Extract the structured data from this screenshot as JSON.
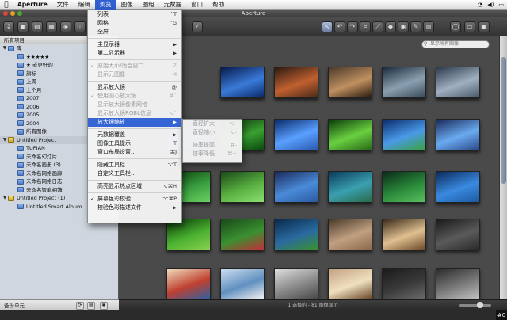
{
  "menubar": {
    "app": "Aperture",
    "items": [
      "文件",
      "编辑",
      "浏览",
      "图像",
      "图组",
      "元数据",
      "窗口",
      "帮助"
    ],
    "active_index": 2
  },
  "window": {
    "title": "Aperture"
  },
  "sidebar": {
    "header": "所有项目",
    "items": [
      {
        "label": "库",
        "level": 0,
        "icon": "folder-icon",
        "expanded": true
      },
      {
        "label": "★★★★★",
        "level": 1,
        "icon": "album-icon"
      },
      {
        "label": "★ 或更好的",
        "level": 1,
        "icon": "album-icon"
      },
      {
        "label": "旗标",
        "level": 1,
        "icon": "album-icon"
      },
      {
        "label": "上周",
        "level": 1,
        "icon": "album-icon"
      },
      {
        "label": "上个月",
        "level": 1,
        "icon": "album-icon"
      },
      {
        "label": "2007",
        "level": 1,
        "icon": "album-icon"
      },
      {
        "label": "2006",
        "level": 1,
        "icon": "album-icon"
      },
      {
        "label": "2005",
        "level": 1,
        "icon": "album-icon"
      },
      {
        "label": "2004",
        "level": 1,
        "icon": "album-icon"
      },
      {
        "label": "所有图像",
        "level": 1,
        "icon": "album-icon"
      },
      {
        "label": "Untitled Project",
        "level": 0,
        "icon": "project-icon",
        "expanded": true,
        "selected": true
      },
      {
        "label": "TUPIAN",
        "level": 1,
        "icon": "album-icon"
      },
      {
        "label": "未命名幻灯片",
        "level": 1,
        "icon": "album-icon"
      },
      {
        "label": "未命名画册 (3)",
        "level": 1,
        "icon": "album-icon"
      },
      {
        "label": "未命名网络画廊",
        "level": 1,
        "icon": "album-icon"
      },
      {
        "label": "未命名网络日志",
        "level": 1,
        "icon": "album-icon"
      },
      {
        "label": "未命名智能相簿",
        "level": 1,
        "icon": "album-icon"
      },
      {
        "label": "Untitled Project (1)",
        "level": 0,
        "icon": "project-icon",
        "expanded": true
      },
      {
        "label": "Untitled Smart Album",
        "level": 1,
        "icon": "album-icon"
      }
    ],
    "footer": "备份单元"
  },
  "browser": {
    "search_placeholder": "显示所有图像",
    "status": "1 选择的 - 81 图像显示"
  },
  "menu": {
    "items": [
      {
        "label": "列表",
        "shortcut": "⌃T"
      },
      {
        "label": "网格",
        "shortcut": "⌃G"
      },
      {
        "label": "全屏",
        "shortcut": ""
      },
      {
        "sep": true
      },
      {
        "label": "主显示器",
        "shortcut": "▶"
      },
      {
        "label": "第二显示器",
        "shortcut": "▶"
      },
      {
        "sep": true
      },
      {
        "label": "原始大小/适合窗口",
        "shortcut": "Z",
        "disabled": true,
        "checked": true
      },
      {
        "label": "显示元图像",
        "shortcut": "M",
        "disabled": true
      },
      {
        "sep": true
      },
      {
        "label": "显示放大镜",
        "shortcut": "@"
      },
      {
        "label": "使用圆心放大镜",
        "shortcut": "⌘`",
        "disabled": true,
        "checked": true
      },
      {
        "label": "显示放大镜像素网格",
        "shortcut": "",
        "disabled": true
      },
      {
        "label": "显示放大镜RGBL信息",
        "shortcut": "⌥`",
        "disabled": true
      },
      {
        "label": "放大镜缩放",
        "shortcut": "▶",
        "highlight": true
      },
      {
        "sep": true
      },
      {
        "label": "元数据覆盖",
        "shortcut": "▶"
      },
      {
        "label": "图像工具提示",
        "shortcut": "T"
      },
      {
        "label": "窗口布局设置...",
        "shortcut": "⌘J"
      },
      {
        "sep": true
      },
      {
        "label": "隐藏工具栏",
        "shortcut": "⌥T"
      },
      {
        "label": "自定义工具栏...",
        "shortcut": ""
      },
      {
        "sep": true
      },
      {
        "label": "高亮显示热点区域",
        "shortcut": "⌥⌘H"
      },
      {
        "sep": true
      },
      {
        "label": "屏幕色彩校验",
        "shortcut": "⌥⌘P",
        "checked": true
      },
      {
        "label": "校验色彩描述文件",
        "shortcut": "▶"
      }
    ]
  },
  "submenu": {
    "items": [
      {
        "label": "直径扩大",
        "shortcut": "⌥-"
      },
      {
        "label": "直径缩小",
        "shortcut": "⌥-"
      },
      {
        "sep": true
      },
      {
        "label": "倍率提高",
        "shortcut": "⌘-"
      },
      {
        "label": "倍率降低",
        "shortcut": "⌘="
      }
    ]
  },
  "corner_badge": "#0",
  "colors": {
    "menu_highlight": "#3666d6",
    "sidebar_bg": "#cfd6df",
    "browser_bg": "#4a4a4a"
  }
}
